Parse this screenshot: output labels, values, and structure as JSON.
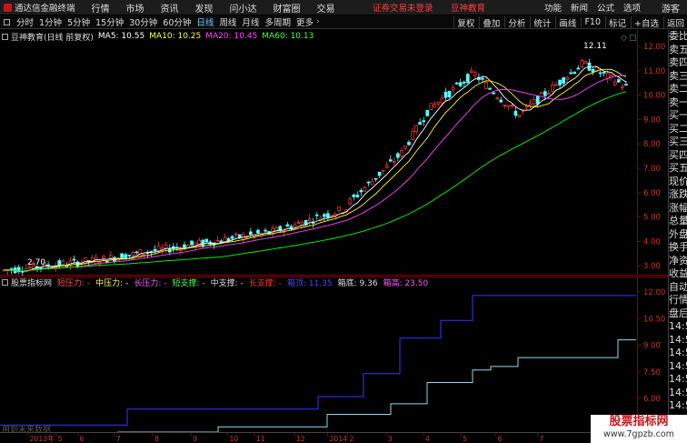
{
  "menubar": {
    "app_name": "通达信金融终端",
    "items": [
      "行情",
      "市场",
      "资讯",
      "发现",
      "问小达",
      "财富圈",
      "交易"
    ],
    "notice": "证券交易未登录",
    "notice2": "豆神教育",
    "right_items": [
      "功能",
      "新闻",
      "公式",
      "选项"
    ],
    "guest": "游客"
  },
  "toolbar": {
    "items": [
      "分时",
      "1分钟",
      "5分钟",
      "15分钟",
      "30分钟",
      "60分钟",
      "日线",
      "周线",
      "月线",
      "多周期",
      "更多"
    ],
    "active": "日线",
    "right_items": [
      "复权",
      "叠加",
      "分析",
      "统计",
      "画线",
      "F10",
      "标记",
      "+自选",
      "返回"
    ]
  },
  "main_header": {
    "stock": "豆神教育(日线 前复权)",
    "ma5": "MA5: 10.55",
    "ma10": "MA10: 10.25",
    "ma20": "MA20: 10.45",
    "ma60": "MA60: 10.13"
  },
  "indicator_header": {
    "name": "股票指标网",
    "items": [
      {
        "label": "短压力: -",
        "color": "#ff5555"
      },
      {
        "label": "中压力: -",
        "color": "#ffff55"
      },
      {
        "label": "长压力: -",
        "color": "#ff55ff"
      },
      {
        "label": "短支撑: -",
        "color": "#55ff55"
      },
      {
        "label": "中支撑: -",
        "color": "#dddddd"
      },
      {
        "label": "长支撑: -",
        "color": "#ff3333"
      },
      {
        "label": "箱顶: 11.35",
        "color": "#4444ff"
      },
      {
        "label": "箱底: 9.36",
        "color": "#dddddd"
      },
      {
        "label": "箱高: 23.50",
        "color": "#ff55ff"
      }
    ]
  },
  "main_axis_labels": [
    "12.00",
    "11.00",
    "10.00",
    "9.00",
    "8.00",
    "7.00",
    "6.00",
    "5.00",
    "4.00",
    "3.00"
  ],
  "sub_axis_labels": [
    "12.00",
    "10.50",
    "9.00",
    "7.50",
    "6.00",
    "4.50"
  ],
  "peak_label": "12.11",
  "low_label": "2.70",
  "side_labels": [
    "委比",
    "卖五",
    "卖四",
    "卖三",
    "卖二",
    "卖一",
    "买一",
    "买二",
    "买三",
    "买四",
    "买五",
    "现价",
    "涨跌",
    "涨幅",
    "总量",
    "外盘",
    "换手",
    "净资",
    "收益",
    "自动",
    "行情",
    "盘后",
    "14:50",
    "14:50",
    "14:50",
    "14:50",
    "14:50",
    "14:50",
    "14:50",
    "14:50"
  ],
  "date_labels": [
    "2013年",
    "5",
    "6",
    "7",
    "8",
    "9",
    "10",
    "11",
    "12",
    "2014",
    "2",
    "3",
    "4",
    "5",
    "6",
    "7"
  ],
  "sub_watermark": "用到未来数据",
  "watermark": {
    "title": "股票指标网",
    "url": "www.7gpzb.com"
  },
  "colors": {
    "up": "#ff3b3b",
    "down": "#54ffff",
    "ma5": "#ffffff",
    "ma10": "#ffff00",
    "ma20": "#ff44ff",
    "ma60": "#00ff00",
    "box_top": "#3333ff",
    "box_bottom": "#88ddee"
  }
}
